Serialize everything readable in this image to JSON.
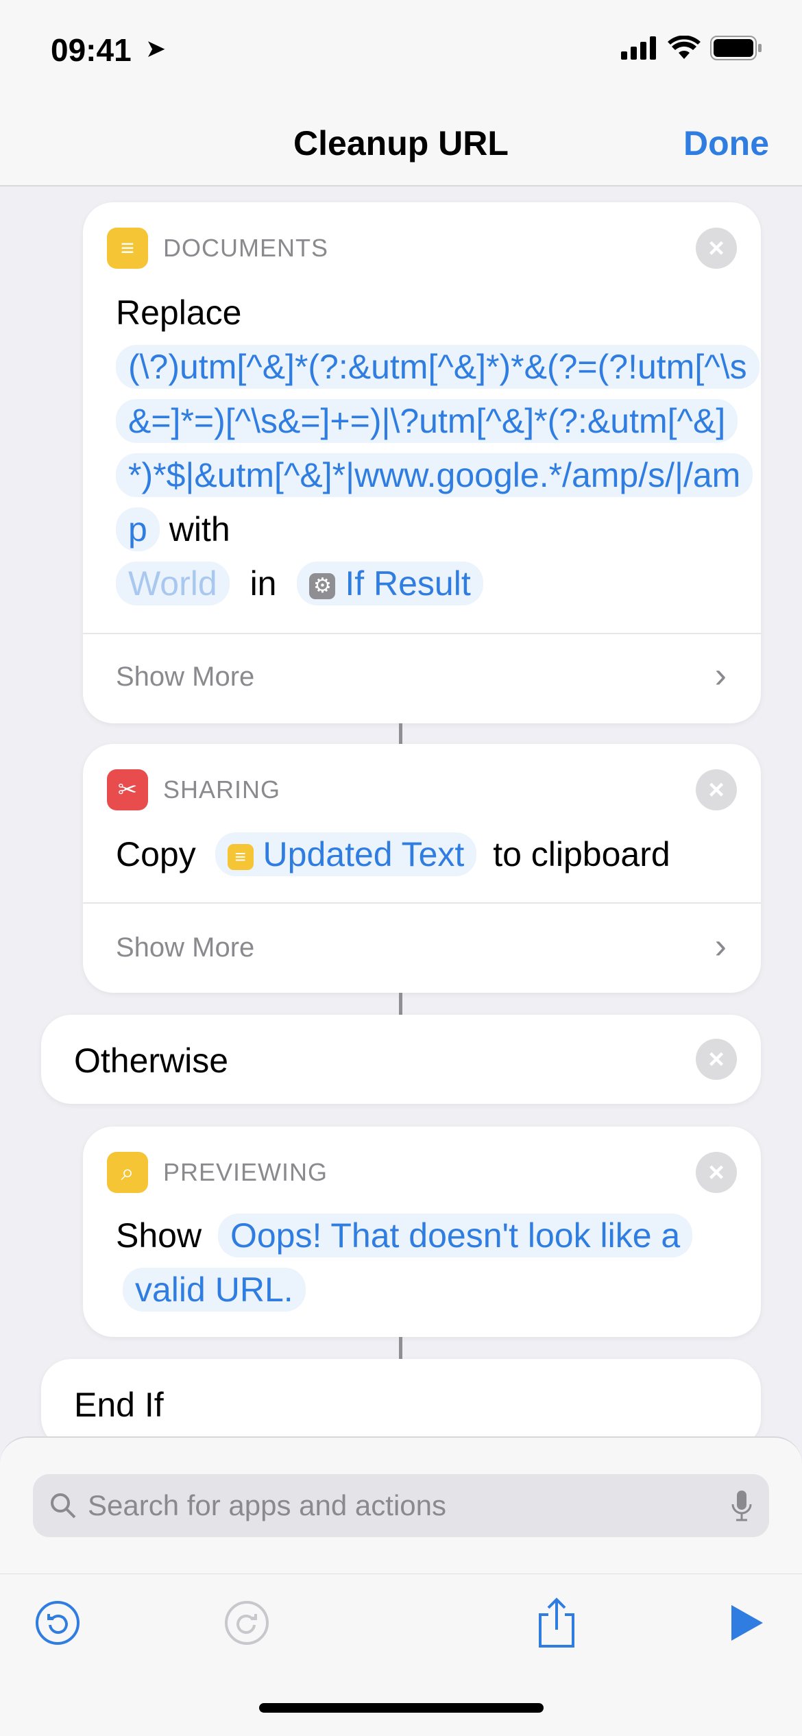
{
  "status": {
    "time": "09:41"
  },
  "nav": {
    "title": "Cleanup URL",
    "done": "Done"
  },
  "actions": [
    {
      "category": "DOCUMENTS",
      "icon": "documents-icon",
      "color": "#f5c536",
      "verb": "Replace",
      "pattern": "(\\?)utm[^&]*(?:&utm[^&]*)*&(?=(?!utm[^\\s&=]*=)[^\\s&=]+=)|\\?utm[^&]*(?:&utm[^&]*)*$|&utm[^&]*|www.google.*/amp/s/|/amp",
      "with": "with",
      "replacement_placeholder": "World",
      "in": "in",
      "input": "If Result",
      "show_more": "Show More"
    },
    {
      "category": "SHARING",
      "icon": "scissors-icon",
      "color": "#e94c4c",
      "verb": "Copy",
      "variable": "Updated Text",
      "suffix": "to clipboard",
      "show_more": "Show More"
    },
    {
      "label": "Otherwise"
    },
    {
      "category": "PREVIEWING",
      "icon": "preview-icon",
      "color": "#f5c536",
      "verb": "Show",
      "message": "Oops! That doesn't look like a valid URL."
    },
    {
      "label": "End If"
    }
  ],
  "search": {
    "placeholder": "Search for apps and actions"
  }
}
